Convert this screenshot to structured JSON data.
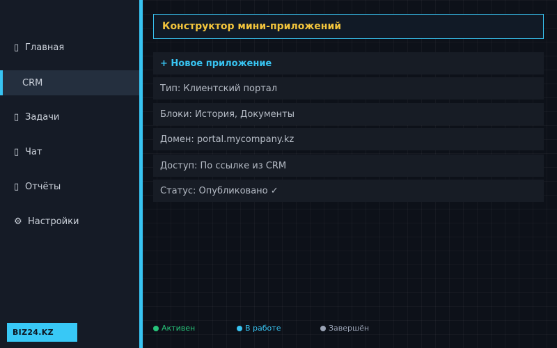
{
  "sidebar": {
    "items": [
      {
        "icon": "▯",
        "label": "Главная"
      },
      {
        "icon": "▯",
        "label": "CRM"
      },
      {
        "icon": "▯",
        "label": "Задачи"
      },
      {
        "icon": "▯",
        "label": "Чат"
      },
      {
        "icon": "▯",
        "label": "Отчёты"
      },
      {
        "icon": "⚙",
        "label": "Настройки"
      }
    ],
    "active_index": 1,
    "brand": "BIZ24.KZ"
  },
  "main": {
    "title": "Конструктор мини-приложений",
    "new_app_label": "+ Новое приложение",
    "rows": [
      "Тип: Клиентский портал",
      "Блоки: История, Документы",
      "Домен: portal.mycompany.kz",
      "Доступ: По ссылке из CRM",
      "Статус: Опубликовано ✓"
    ]
  },
  "legend": [
    {
      "label": "Активен",
      "color": "#27c47a"
    },
    {
      "label": "В работе",
      "color": "#38c4f2"
    },
    {
      "label": "Завершён",
      "color": "#9aa3b5"
    }
  ],
  "colors": {
    "accent": "#38c4f2",
    "title": "#f3c53c",
    "background": "#0d1119",
    "sidebar": "#151b26"
  }
}
